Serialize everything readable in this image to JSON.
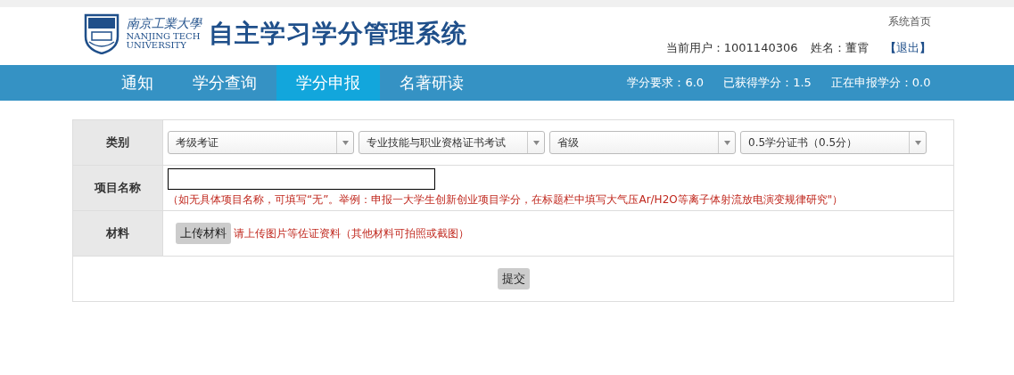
{
  "header": {
    "school_name_cn": "南京工業大學",
    "school_name_en_1": "NANJING TECH",
    "school_name_en_2": "UNIVERSITY",
    "system_title": "自主学习学分管理系统",
    "home_link": "系统首页",
    "user_label": "当前用户：1001140306",
    "name_label": "姓名：",
    "name_value": "董霄",
    "logout_open": "【",
    "logout_link": "退出",
    "logout_close": "】"
  },
  "nav": {
    "tabs": [
      {
        "label": "通知",
        "selected": false
      },
      {
        "label": "学分查询",
        "selected": false
      },
      {
        "label": "学分申报",
        "selected": true
      },
      {
        "label": "名著研读",
        "selected": false
      }
    ],
    "stats": [
      "学分要求：6.0",
      "已获得学分：1.5",
      "正在申报学分：0.0"
    ]
  },
  "form": {
    "category": {
      "label": "类别",
      "selects": [
        "考级考证",
        "专业技能与职业资格证书考试",
        "省级",
        "0.5学分证书（0.5分）"
      ]
    },
    "project": {
      "label": "项目名称",
      "hint": "（如无具体项目名称，可填写“无”。举例：申报一大学生创新创业项目学分，在标题栏中填写大气压Ar/H2O等离子体射流放电演变规律研究\"）"
    },
    "material": {
      "label": "材料",
      "upload_button": "上传材料",
      "hint": "请上传图片等佐证资料（其他材料可拍照或截图）"
    },
    "submit_button": "提交"
  }
}
